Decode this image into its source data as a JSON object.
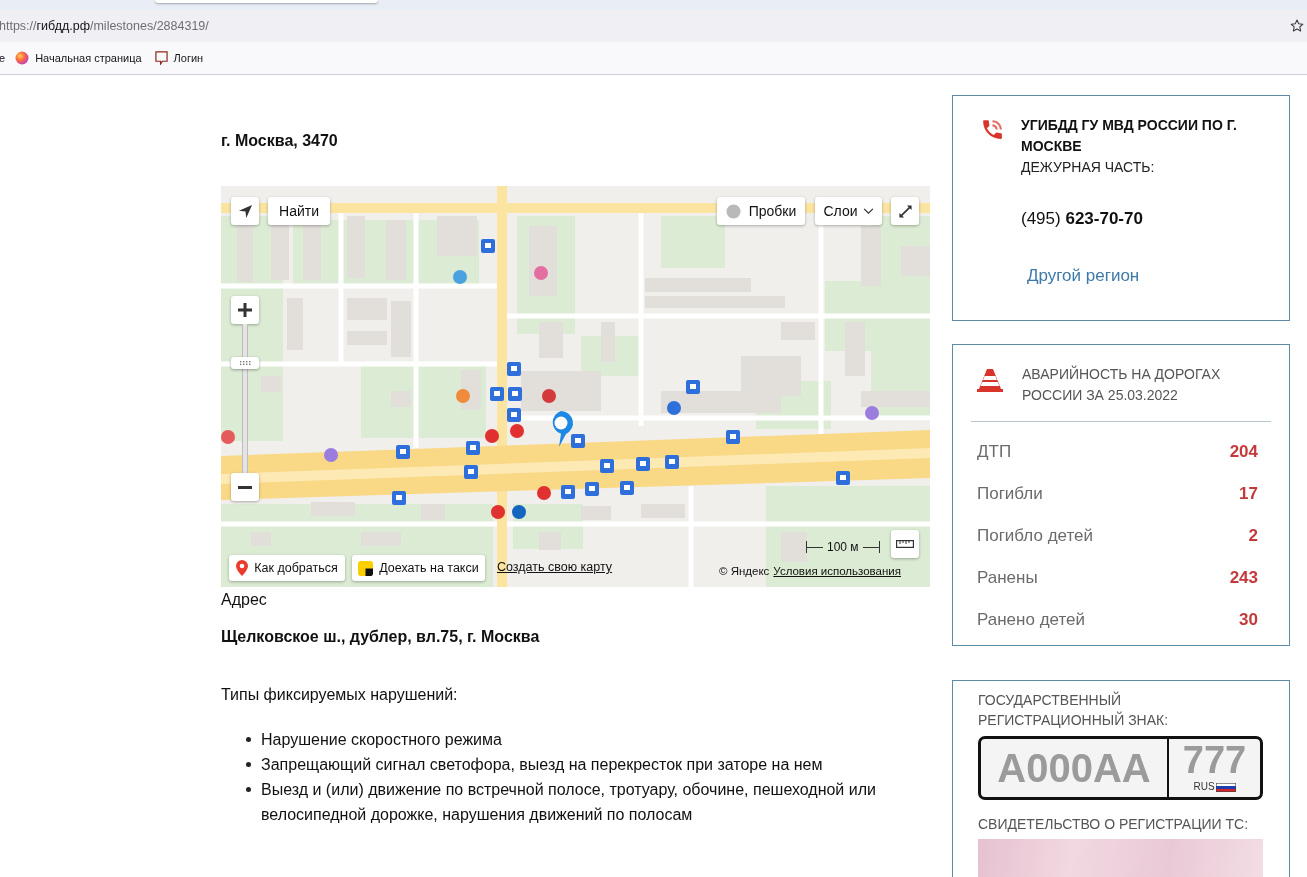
{
  "browser": {
    "url": {
      "scheme": "https://",
      "host": "гибдд.рф",
      "path": "/milestones/2884319/"
    },
    "bookmarks": [
      {
        "kind": "cut",
        "label": "е"
      },
      {
        "kind": "home",
        "label": "Начальная страница"
      },
      {
        "kind": "login",
        "label": "Логин"
      }
    ]
  },
  "page": {
    "title": "г. Москва, 3470",
    "map": {
      "search_button": "Найти",
      "traffic_button": "Пробки",
      "layers_button": "Слои",
      "zoom": {
        "level": 0.74
      },
      "route_button": "Как добраться",
      "taxi_button": "Доехать на такси",
      "create_map_link": "Создать свою карту",
      "scale": "100 м",
      "copyright": "© Яндекс",
      "terms_link": "Условия использования"
    },
    "address_label": "Адрес",
    "address": "Щелковское ш., дублер, вл.75, г. Москва",
    "violations_title": "Типы фиксируемых нарушений:",
    "violations": [
      "Нарушение скоростного режима",
      "Запрещающий сигнал светофора, выезд на перекресток при заторе на нем",
      "Выезд и (или) движение по встречной полосе, тротуару, обочине, пешеходной или велосипедной дорожке, нарушения движений по полосам"
    ]
  },
  "sidebar": {
    "contact": {
      "title": "УГИБДД ГУ МВД РОССИИ ПО Г. МОСКВЕ",
      "subtitle": "ДЕЖУРНАЯ ЧАСТЬ:",
      "phone": "(495) **623-70-70**",
      "region_link": "Другой регион"
    },
    "accidents": {
      "title": "АВАРИЙНОСТЬ НА ДОРОГАХ РОССИИ ЗА 25.03.2022",
      "rows": [
        {
          "label": "ДТП",
          "value": "204"
        },
        {
          "label": "Погибли",
          "value": "17"
        },
        {
          "label": "Погибло детей",
          "value": "2"
        },
        {
          "label": "Ранены",
          "value": "243"
        },
        {
          "label": "Ранено детей",
          "value": "30"
        }
      ]
    },
    "documents": {
      "plate_title": "ГОСУДАРСТВЕННЫЙ РЕГИСТРАЦИОННЫЙ ЗНАК:",
      "plate": {
        "number": "А000АА",
        "region": "777",
        "country": "RUS"
      },
      "certificate_title": "СВИДЕТЕЛЬСТВО О РЕГИСТРАЦИИ ТС:"
    }
  }
}
